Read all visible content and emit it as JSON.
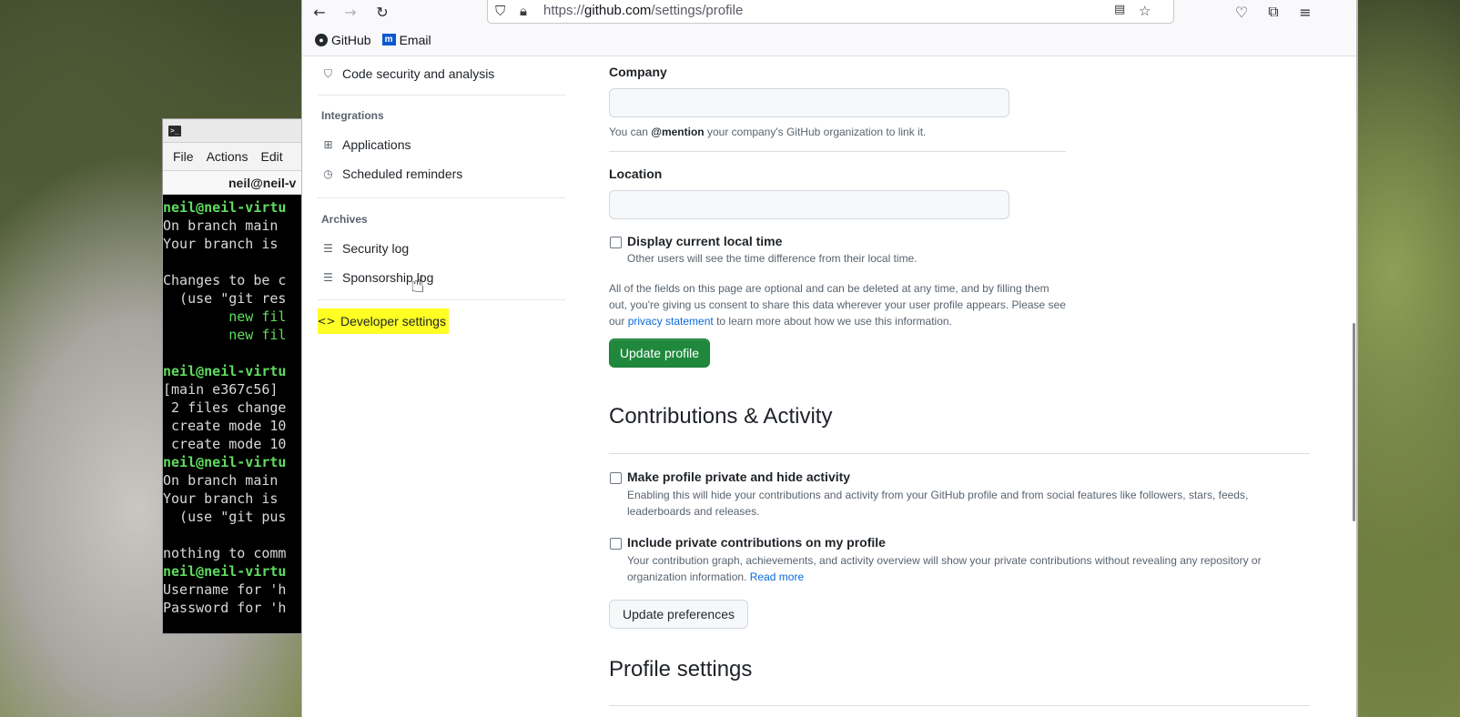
{
  "terminal": {
    "menu": [
      "File",
      "Actions",
      "Edit"
    ],
    "tab_title": "neil@neil-v",
    "lines": [
      {
        "text": "neil@neil-virtu",
        "kind": "prompt"
      },
      {
        "text": "On branch main",
        "kind": "normal"
      },
      {
        "text": "Your branch is",
        "kind": "normal"
      },
      {
        "text": "",
        "kind": "normal"
      },
      {
        "text": "Changes to be c",
        "kind": "normal"
      },
      {
        "text": "  (use \"git res",
        "kind": "normal"
      },
      {
        "text": "        new fil",
        "kind": "added"
      },
      {
        "text": "        new fil",
        "kind": "added"
      },
      {
        "text": "",
        "kind": "normal"
      },
      {
        "text": "neil@neil-virtu",
        "kind": "prompt"
      },
      {
        "text": "[main e367c56]",
        "kind": "normal"
      },
      {
        "text": " 2 files change",
        "kind": "normal"
      },
      {
        "text": " create mode 10",
        "kind": "normal"
      },
      {
        "text": " create mode 10",
        "kind": "normal"
      },
      {
        "text": "neil@neil-virtu",
        "kind": "prompt"
      },
      {
        "text": "On branch main",
        "kind": "normal"
      },
      {
        "text": "Your branch is",
        "kind": "normal"
      },
      {
        "text": "  (use \"git pus",
        "kind": "normal"
      },
      {
        "text": "",
        "kind": "normal"
      },
      {
        "text": "nothing to comm",
        "kind": "normal"
      },
      {
        "text": "neil@neil-virtu",
        "kind": "prompt"
      },
      {
        "text": "Username for 'h",
        "kind": "normal"
      },
      {
        "text": "Password for 'h",
        "kind": "normal"
      }
    ]
  },
  "browser": {
    "url_scheme": "https://",
    "url_host": "github.com",
    "url_path": "/settings/profile",
    "bookmarks": [
      "GitHub",
      "Email"
    ]
  },
  "sidebar": {
    "code_security": "Code security and analysis",
    "integrations_heading": "Integrations",
    "applications": "Applications",
    "scheduled_reminders": "Scheduled reminders",
    "archives_heading": "Archives",
    "security_log": "Security log",
    "sponsorship_log": "Sponsorship log",
    "developer_settings": "Developer settings"
  },
  "form": {
    "company_label": "Company",
    "company_value": "",
    "company_hint_pre": "You can ",
    "company_hint_mention": "@mention",
    "company_hint_post": " your company's GitHub organization to link it.",
    "location_label": "Location",
    "location_value": "",
    "local_time_label": "Display current local time",
    "local_time_hint": "Other users will see the time difference from their local time.",
    "optional_line1": "All of the fields on this page are optional and can be deleted at any time, and by filling them",
    "optional_line2": "out, you're giving us consent to share this data wherever your user profile appears. Please see",
    "optional_line3_pre": "our ",
    "privacy_link": "privacy statement",
    "optional_line3_post": " to learn more about how we use this information.",
    "update_profile": "Update profile"
  },
  "contributions": {
    "title": "Contributions & Activity",
    "private_label": "Make profile private and hide activity",
    "private_hint1": "Enabling this will hide your contributions and activity from your GitHub profile and from social features like followers, stars, feeds,",
    "private_hint2": "leaderboards and releases.",
    "include_label": "Include private contributions on my profile",
    "include_hint1": "Your contribution graph, achievements, and activity overview will show your private contributions without revealing any repository or",
    "include_hint2_pre": "organization information. ",
    "read_more": "Read more",
    "update_preferences": "Update preferences"
  },
  "profile_settings_title": "Profile settings"
}
